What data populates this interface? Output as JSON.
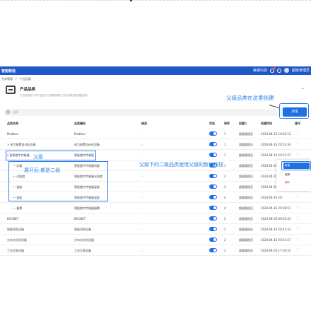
{
  "header": {
    "brand": "智能制造",
    "right_label": "美泰内容",
    "user": "超级管理员"
  },
  "breadcrumb": [
    "业务管理",
    "产品品类"
  ],
  "card": {
    "title": "产品品类",
    "description": "产品品类用于对产品进行分类管理维护,支持多级品类层级结构",
    "collapse_icon": "^"
  },
  "annotations": {
    "parent_create": "父级品类在这里创建",
    "parent_label": "父级",
    "children_label": "展开后,都是二级",
    "child_create": "父级下的二级品类使用父级的新增按钮"
  },
  "search": {
    "placeholder": "搜索"
  },
  "toolbar": {
    "create_label": "新增"
  },
  "table": {
    "columns": [
      "品类名称",
      "品类编码",
      "描述",
      "状态",
      "排序",
      "创建人",
      "创建时间",
      "操作"
    ],
    "rows": [
      {
        "name": "Modbus",
        "code": "Modbus",
        "desc": "-",
        "sort": "1",
        "creator": "超级管理员",
        "time": "2024-04-22 10:02:12"
      },
      {
        "name": "> 电力配置自动化设备",
        "code": "电力配置自动化设备",
        "desc": "-",
        "sort": "1",
        "creator": "超级管理员",
        "time": "2024-04-16 20:24:34"
      },
      {
        "name": "v 智能楼宇传感器",
        "code": "智能楼宇传感器",
        "desc": "-",
        "sort": "1",
        "creator": "超级管理员",
        "time": "2024-04-16 20:23:47"
      },
      {
        "name": "一 风量",
        "code": "智能楼宇传感器风量",
        "desc": "-",
        "sort": "1",
        "creator": "超级管理员",
        "time": "2024-04-16 20:"
      },
      {
        "name": "一 光照度",
        "code": "智能楼宇传感器光照度",
        "desc": "-",
        "sort": "2",
        "creator": "超级管理员",
        "time": "2024-04-16 20:"
      },
      {
        "name": "一 湿度",
        "code": "智能楼宇传感器湿度",
        "desc": "-",
        "sort": "3",
        "creator": "超级管理员",
        "time": "2024-04-16 20:"
      },
      {
        "name": "一 温度",
        "code": "智能楼宇传感器温度",
        "desc": "-",
        "sort": "4",
        "creator": "超级管理员",
        "time": "2024-04-16 20:"
      },
      {
        "name": "一 烟雾",
        "code": "智能楼宇传感器烟雾",
        "desc": "-",
        "sort": "4",
        "creator": "超级管理员",
        "time": "2024-04-16 20:28:51"
      },
      {
        "name": "BACNET",
        "code": "BACNET",
        "desc": "-",
        "sort": "2",
        "creator": "超级管理员",
        "time": "2024-04-03 09:01:43"
      },
      {
        "name": "智能消防设备",
        "code": "智能消防设备",
        "desc": "-",
        "sort": "2",
        "creator": "超级管理员",
        "time": "2024-04-16 20:43:33"
      },
      {
        "name": "分布式光伏设备",
        "code": "分布式光伏设备",
        "desc": "-",
        "sort": "2",
        "creator": "超级管理员",
        "time": "2024-04-16 20:22:57"
      },
      {
        "name": "工业互联设备",
        "code": "工业互联设备",
        "desc": "-",
        "sort": "3",
        "creator": "超级管理员",
        "time": "2024-04-03 17:04:55"
      }
    ]
  },
  "dropdown": {
    "items": [
      "新增",
      "编辑",
      "删除"
    ]
  },
  "colors": {
    "primary": "#1f6fe5",
    "annotation": "#2a7fe8",
    "header": "#1f56c9",
    "danger": "#e44444"
  }
}
